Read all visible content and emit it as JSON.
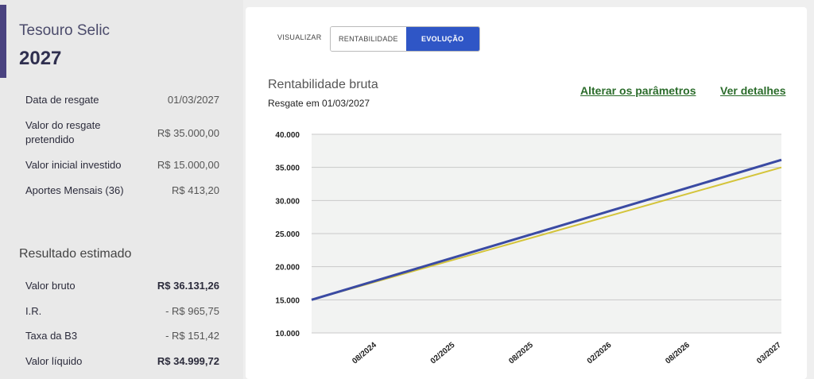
{
  "product": {
    "name": "Tesouro Selic",
    "year": "2027"
  },
  "params": [
    {
      "label": "Data de resgate",
      "value": "01/03/2027"
    },
    {
      "label": "Valor do resgate pretendido",
      "value": "R$ 35.000,00"
    },
    {
      "label": "Valor inicial investido",
      "value": "R$ 15.000,00"
    },
    {
      "label": "Aportes Mensais (36)",
      "value": "R$ 413,20"
    }
  ],
  "results": {
    "title": "Resultado estimado",
    "rows": [
      {
        "label": "Valor bruto",
        "value": "R$ 36.131,26"
      },
      {
        "label": "I.R.",
        "value": "- R$ 965,75"
      },
      {
        "label": "Taxa da B3",
        "value": "- R$ 151,42"
      },
      {
        "label": "Valor líquido",
        "value": "R$ 34.999,72"
      }
    ]
  },
  "toolbar": {
    "label": "VISUALIZAR",
    "options": [
      "RENTABILIDADE",
      "EVOLUÇÃO"
    ],
    "active": "EVOLUÇÃO"
  },
  "chart_header": {
    "title": "Rentabilidade bruta",
    "subtitle": "Resgate em 01/03/2027",
    "alter_link": "Alterar os parâmetros",
    "details_link": "Ver detalhes"
  },
  "colors": {
    "accent": "#4a4380",
    "active_button": "#2f56c6",
    "link": "#2b6c2b",
    "series_gross": "#3a4aa3",
    "series_target": "#d4c43a"
  },
  "chart_data": {
    "type": "line",
    "ylim": [
      10000,
      40000
    ],
    "yticks": [
      "10.000",
      "15.000",
      "20.000",
      "25.000",
      "30.000",
      "35.000",
      "40.000"
    ],
    "ytick_values": [
      10000,
      15000,
      20000,
      25000,
      30000,
      35000,
      40000
    ],
    "xlim": [
      "2024-03",
      "2027-03"
    ],
    "xticks": [
      "08/2024",
      "02/2025",
      "08/2025",
      "02/2026",
      "08/2026",
      "03/2027"
    ],
    "xtick_dates": [
      "2024-08",
      "2025-02",
      "2025-08",
      "2026-02",
      "2026-08",
      "2027-03"
    ],
    "grid": true,
    "series": [
      {
        "color": "#3a4aa3",
        "points": [
          [
            "2024-03",
            15000
          ],
          [
            "2027-03",
            36131
          ]
        ]
      },
      {
        "color": "#d4c43a",
        "points": [
          [
            "2024-03",
            15000
          ],
          [
            "2027-03",
            35000
          ]
        ]
      }
    ]
  }
}
